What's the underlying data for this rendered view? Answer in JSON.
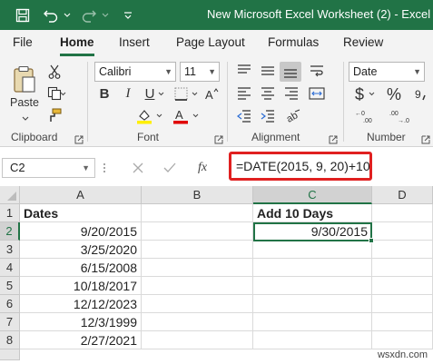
{
  "window": {
    "title": "New Microsoft Excel Worksheet (2)  -  Excel"
  },
  "tabs": [
    "File",
    "Home",
    "Insert",
    "Page Layout",
    "Formulas",
    "Review"
  ],
  "ribbon": {
    "clipboard": {
      "paste_label": "Paste",
      "group_label": "Clipboard"
    },
    "font": {
      "font_name": "Calibri",
      "font_size": "11",
      "group_label": "Font"
    },
    "alignment": {
      "group_label": "Alignment"
    },
    "number": {
      "format": "Date",
      "currency_symbol": "$",
      "percent_symbol": "%",
      "group_label": "Number"
    }
  },
  "formula_bar": {
    "name_box": "C2",
    "fx_label": "fx",
    "formula": "=DATE(2015, 9, 20)+10"
  },
  "sheet": {
    "columns": [
      "A",
      "B",
      "C",
      "D"
    ],
    "selected_column": "C",
    "selected_row": "2",
    "rows": [
      {
        "num": "1",
        "a": "Dates",
        "b": "",
        "c": "Add 10 Days"
      },
      {
        "num": "2",
        "a": "9/20/2015",
        "b": "",
        "c": "9/30/2015"
      },
      {
        "num": "3",
        "a": "3/25/2020",
        "b": "",
        "c": ""
      },
      {
        "num": "4",
        "a": "6/15/2008",
        "b": "",
        "c": ""
      },
      {
        "num": "5",
        "a": "10/18/2017",
        "b": "",
        "c": ""
      },
      {
        "num": "6",
        "a": "12/12/2023",
        "b": "",
        "c": ""
      },
      {
        "num": "7",
        "a": "12/3/1999",
        "b": "",
        "c": ""
      },
      {
        "num": "8",
        "a": "2/27/2021",
        "b": "",
        "c": ""
      }
    ]
  },
  "watermark": "wsxdn.com",
  "colors": {
    "excel_green": "#217346",
    "highlight_red": "#e02020"
  }
}
